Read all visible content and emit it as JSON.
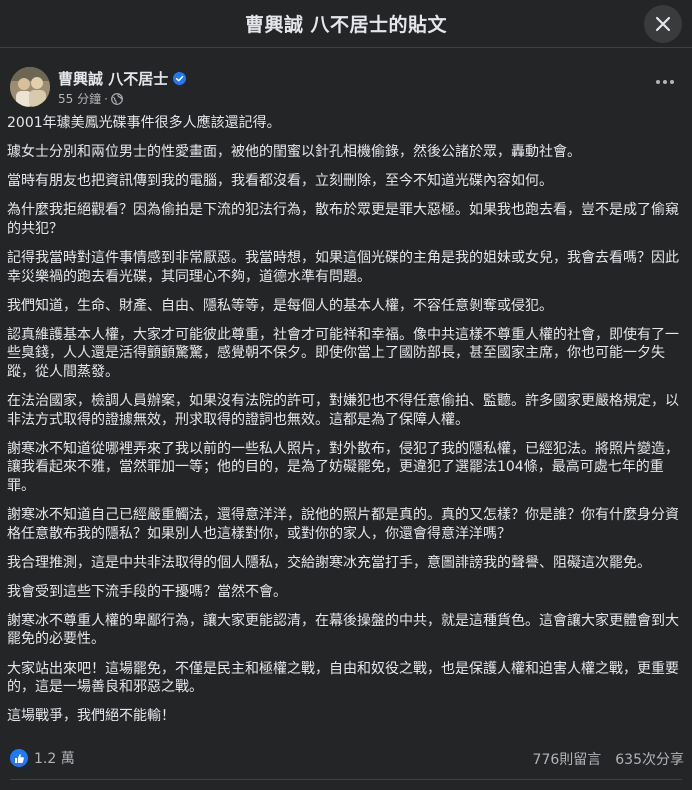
{
  "dialog": {
    "title": "曹興誠 八不居士的貼文",
    "close_icon": "close-icon"
  },
  "post": {
    "author": "曹興誠 八不居士",
    "verified_icon": "verified-badge-icon",
    "time": "55 分鐘",
    "separator": "·",
    "privacy_icon": "public-globe-icon",
    "more_icon": "more-options-icon",
    "paragraphs": [
      "2001年璩美鳳光碟事件很多人應該還記得。",
      "璩女士分別和兩位男士的性愛畫面，被他的閨蜜以針孔相機偷錄，然後公諸於眾，轟動社會。",
      "當時有朋友也把資訊傳到我的電腦，我看都沒看，立刻刪除，至今不知道光碟內容如何。",
      "為什麼我拒絕觀看？因為偷拍是下流的犯法行為，散布於眾更是罪大惡極。如果我也跑去看，豈不是成了偷窺的共犯？",
      "記得我當時對這件事情感到非常厭惡。我當時想，如果這個光碟的主角是我的姐妹或女兒，我會去看嗎？因此幸災樂禍的跑去看光碟，其同理心不夠，道德水準有問題。",
      "我們知道，生命、財產、自由、隱私等等，是每個人的基本人權，不容任意剝奪或侵犯。",
      "認真維護基本人權，大家才可能彼此尊重，社會才可能祥和幸福。像中共這樣不尊重人權的社會，即使有了一些臭錢，人人還是活得顫顫驚驚，感覺朝不保夕。即使你當上了國防部長，甚至國家主席，你也可能一夕失蹤，從人間蒸發。",
      "在法治國家，檢調人員辦案，如果沒有法院的許可，對嫌犯也不得任意偷拍、監聽。許多國家更嚴格規定，以非法方式取得的證據無效，刑求取得的證詞也無效。這都是為了保障人權。",
      "謝寒冰不知道從哪裡弄來了我以前的一些私人照片，對外散布，侵犯了我的隱私權，已經犯法。將照片變造，讓我看起來不雅，當然罪加一等；他的目的，是為了妨礙罷免，更違犯了選罷法104條，最高可處七年的重罪。",
      "謝寒冰不知道自己已經嚴重觸法，還得意洋洋，說他的照片都是真的。真的又怎樣？你是誰？你有什麼身分資格任意散布我的隱私？如果別人也這樣對你，或對你的家人，你還會得意洋洋嗎？",
      "我合理推測，這是中共非法取得的個人隱私，交給謝寒冰充當打手，意圖誹謗我的聲譽、阻礙這次罷免。",
      "我會受到這些下流手段的干擾嗎？當然不會。",
      "謝寒冰不尊重人權的卑鄙行為，讓大家更能認清，在幕後操盤的中共，就是這種貨色。這會讓大家更體會到大罷免的必要性。",
      "大家站出來吧！這場罷免，不僅是民主和極權之戰，自由和奴役之戰，也是保護人權和迫害人權之戰，更重要的，這是一場善良和邪惡之戰。",
      "這場戰爭，我們絕不能輸！"
    ]
  },
  "footer": {
    "like_icon": "thumbs-up-icon",
    "reaction_count": "1.2 萬",
    "comments": "776則留言",
    "shares": "635次分享"
  },
  "colors": {
    "background": "#242526",
    "text": "#e4e6eb",
    "secondary_text": "#b0b3b8",
    "accent": "#2078f4"
  }
}
